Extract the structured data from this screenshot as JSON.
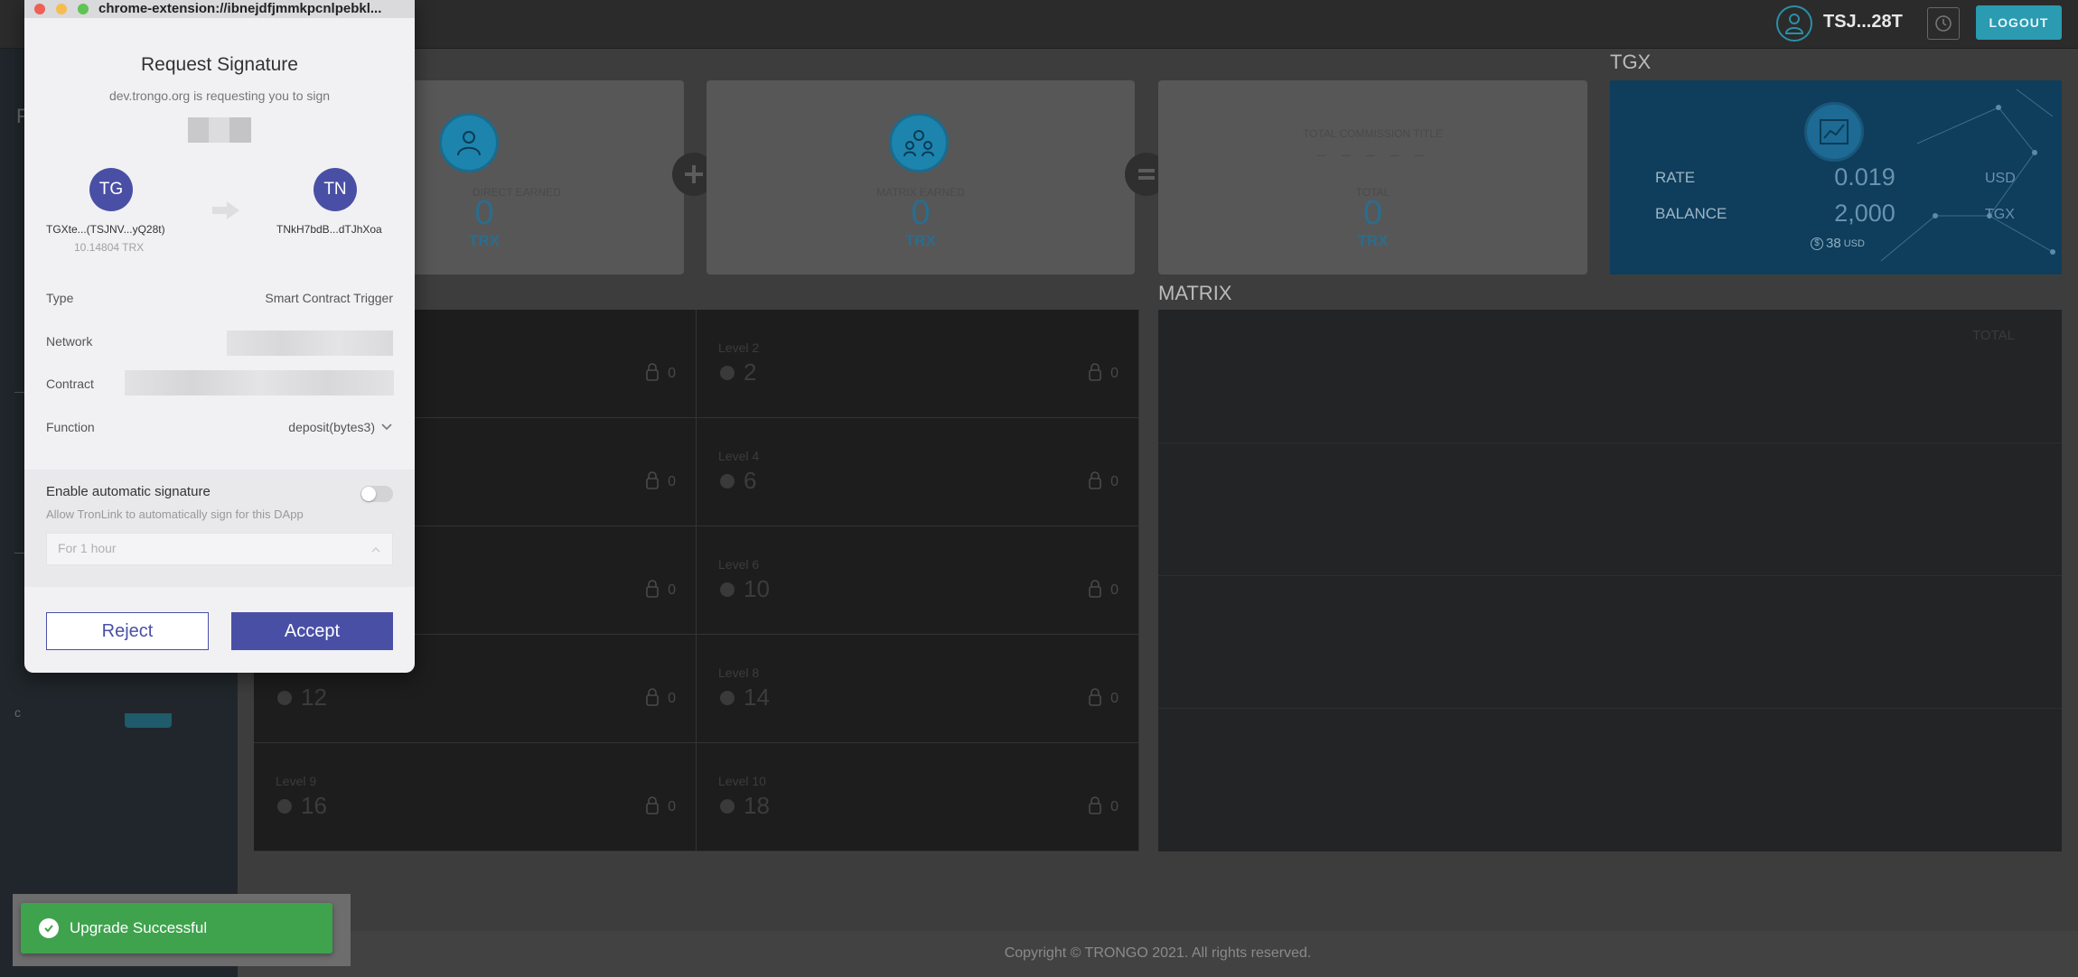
{
  "header": {
    "user_name": "TSJ...28T",
    "logout_label": "LOGOUT"
  },
  "cards": {
    "direct": {
      "label": "DIRECT EARNED",
      "value": "0",
      "unit": "TRX"
    },
    "matrix": {
      "label": "MATRIX EARNED",
      "value": "0",
      "unit": "TRX"
    },
    "total": {
      "title": "TOTAL COMMISSION TITLE",
      "dashes": "– – – – –",
      "label": "TOTAL",
      "value": "0",
      "unit": "TRX"
    }
  },
  "tgx": {
    "title": "TGX",
    "rate_label": "RATE",
    "rate_value": "0.019",
    "rate_unit": "USD",
    "balance_label": "BALANCE",
    "balance_value": "2,000",
    "balance_unit": "TGX",
    "usd_value": "38",
    "usd_unit": "USD",
    "usd_symbol": "$"
  },
  "matrix": {
    "title": "MATRIX",
    "total_label": "TOTAL"
  },
  "levels": [
    {
      "label": "",
      "value": "",
      "count": "0"
    },
    {
      "label": "Level 2",
      "value": "2",
      "count": "0"
    },
    {
      "label": "",
      "value": "",
      "count": "0"
    },
    {
      "label": "Level 4",
      "value": "6",
      "count": "0"
    },
    {
      "label": "",
      "value": "",
      "count": "0"
    },
    {
      "label": "Level 6",
      "value": "10",
      "count": "0"
    },
    {
      "label": "",
      "value": "12",
      "count": "0"
    },
    {
      "label": "Level 8",
      "value": "14",
      "count": "0"
    },
    {
      "label": "Level 9",
      "value": "16",
      "count": "0"
    },
    {
      "label": "Level 10",
      "value": "18",
      "count": "0"
    }
  ],
  "footer": {
    "copyright": "Copyright © TRONGO 2021. All rights reserved."
  },
  "popup": {
    "url": "chrome-extension://ibnejdfjmmkpcnlpebkl...",
    "heading": "Request Signature",
    "subheading": "dev.trongo.org is requesting you to sign",
    "from_initials": "TG",
    "from_address": "TGXte...(TSJNV...yQ28t)",
    "from_balance": "10.14804 TRX",
    "to_initials": "TN",
    "to_address": "TNkH7bdB...dTJhXoa",
    "type_label": "Type",
    "type_value": "Smart Contract Trigger",
    "network_label": "Network",
    "contract_label": "Contract",
    "function_label": "Function",
    "function_value": "deposit(bytes3)",
    "auto_title": "Enable automatic signature",
    "auto_sub": "Allow TronLink to automatically sign for this DApp",
    "duration_value": "For 1 hour",
    "reject_label": "Reject",
    "accept_label": "Accept"
  },
  "toast": {
    "message": "Upgrade Successful"
  },
  "colors": {
    "accent_teal": "#2a9bb0",
    "tronlink_purple": "#4a4fa6",
    "success_green": "#3fa34d",
    "tgx_card_bg": "#0f3d5c"
  }
}
